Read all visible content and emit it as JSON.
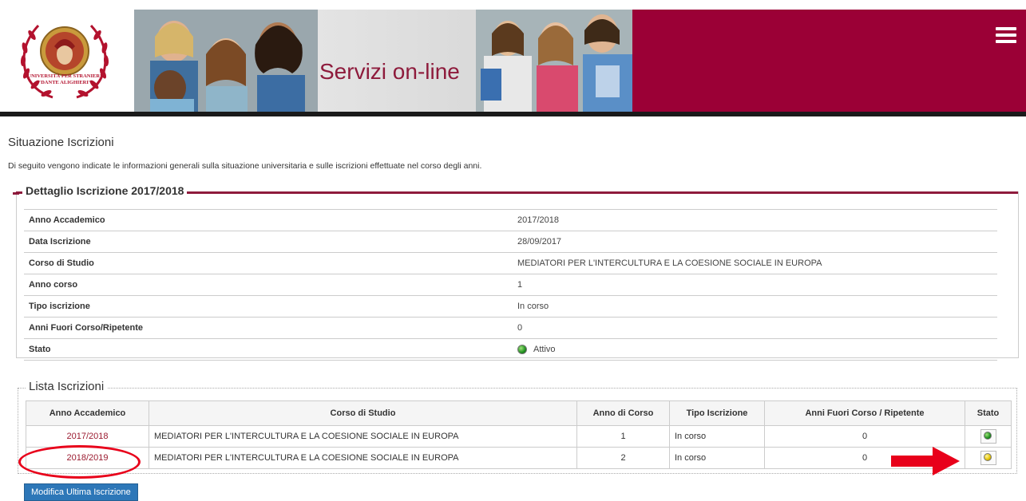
{
  "header": {
    "banner_title": "Servizi on-line",
    "logo_text_line1": "UNIVERSITÀ PER STRANIERI",
    "logo_text_line2": "\"DANTE ALIGHIERI\"",
    "menu_icon": "hamburger-icon",
    "brand_color": "#9b0036"
  },
  "page": {
    "title": "Situazione Iscrizioni",
    "description": "Di seguito vengono indicate le informazioni generali sulla situazione universitaria e sulle iscrizioni effettuate nel corso degli anni."
  },
  "detail": {
    "legend": "Dettaglio Iscrizione 2017/2018",
    "rows": [
      {
        "label": "Anno Accademico",
        "value": "2017/2018"
      },
      {
        "label": "Data Iscrizione",
        "value": "28/09/2017"
      },
      {
        "label": "Corso di Studio",
        "value": "MEDIATORI PER L'INTERCULTURA E LA COESIONE SOCIALE IN EUROPA"
      },
      {
        "label": "Anno corso",
        "value": "1"
      },
      {
        "label": "Tipo iscrizione",
        "value": "In corso"
      },
      {
        "label": "Anni Fuori Corso/Ripetente",
        "value": "0"
      },
      {
        "label": "Stato",
        "value": "Attivo",
        "status_color": "green"
      }
    ]
  },
  "list": {
    "legend": "Lista Iscrizioni",
    "columns": [
      "Anno Accademico",
      "Corso di Studio",
      "Anno di Corso",
      "Tipo Iscrizione",
      "Anni Fuori Corso / Ripetente",
      "Stato"
    ],
    "rows": [
      {
        "anno": "2017/2018",
        "corso": "MEDIATORI PER L'INTERCULTURA E LA COESIONE SOCIALE IN EUROPA",
        "anno_corso": "1",
        "tipo": "In corso",
        "fuori_corso": "0",
        "stato": "green"
      },
      {
        "anno": "2018/2019",
        "corso": "MEDIATORI PER L'INTERCULTURA E LA COESIONE SOCIALE IN EUROPA",
        "anno_corso": "2",
        "tipo": "In corso",
        "fuori_corso": "0",
        "stato": "yellow"
      }
    ]
  },
  "actions": {
    "modify_label": "Modifica Ultima Iscrizione"
  },
  "colors": {
    "accent": "#8e1b3c",
    "link": "#9b1b30",
    "button": "#2d77b8",
    "annotation": "#e8001a"
  }
}
